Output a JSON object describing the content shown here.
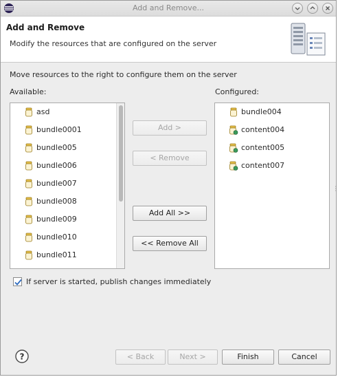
{
  "window": {
    "title": "Add and Remove...",
    "app_icon": "eclipse-icon",
    "controls": [
      "minimize-icon",
      "maximize-icon",
      "close-icon"
    ]
  },
  "header": {
    "title": "Add and Remove",
    "description": "Modify the resources that are configured on the server",
    "image_icon": "server-wizard-icon"
  },
  "main": {
    "instruction": "Move resources to the right to configure them on the server",
    "available_label": "Available:",
    "configured_label": "Configured:",
    "available_items": [
      {
        "label": "asd",
        "icon": "bundle-icon"
      },
      {
        "label": "bundle0001",
        "icon": "bundle-icon"
      },
      {
        "label": "bundle005",
        "icon": "bundle-icon"
      },
      {
        "label": "bundle006",
        "icon": "bundle-icon"
      },
      {
        "label": "bundle007",
        "icon": "bundle-icon"
      },
      {
        "label": "bundle008",
        "icon": "bundle-icon"
      },
      {
        "label": "bundle009",
        "icon": "bundle-icon"
      },
      {
        "label": "bundle010",
        "icon": "bundle-icon"
      },
      {
        "label": "bundle011",
        "icon": "bundle-icon"
      }
    ],
    "configured_items": [
      {
        "label": "bundle004",
        "icon": "bundle-icon"
      },
      {
        "label": "content004",
        "icon": "content-bundle-icon"
      },
      {
        "label": "content005",
        "icon": "content-bundle-icon"
      },
      {
        "label": "content007",
        "icon": "content-bundle-icon"
      }
    ],
    "buttons": {
      "add": "Add >",
      "remove": "< Remove",
      "add_all": "Add All >>",
      "remove_all": "<< Remove All"
    },
    "publish_checkbox": {
      "label": "If server is started, publish changes immediately",
      "checked": true
    }
  },
  "footer": {
    "help_icon": "help-icon",
    "back": "< Back",
    "next": "Next >",
    "finish": "Finish",
    "cancel": "Cancel"
  },
  "colors": {
    "dialog_bg": "#ededed",
    "header_bg": "#ffffff",
    "checkbox_check": "#2e6bbf",
    "content_badge": "#3b9a5a"
  }
}
